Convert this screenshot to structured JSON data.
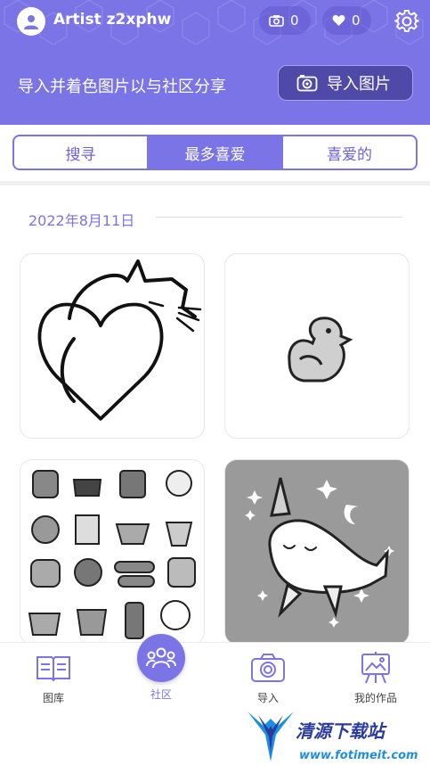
{
  "header": {
    "username": "Artist z2xphw",
    "uploads_count": "0",
    "likes_count": "0",
    "tagline": "导入并着色图片以与社区分享",
    "import_button": "导入图片"
  },
  "tabs": [
    {
      "label": "搜寻",
      "active": false
    },
    {
      "label": "最多喜爱",
      "active": true
    },
    {
      "label": "喜爱的",
      "active": false
    }
  ],
  "feed": {
    "date": "2022年8月11日",
    "items": [
      {
        "subject": "cat heart outline"
      },
      {
        "subject": "rubber duck"
      },
      {
        "subject": "kawaii food collection"
      },
      {
        "subject": "narwhal with stars and moon"
      }
    ]
  },
  "bottom_nav": [
    {
      "label": "图库",
      "icon": "book-icon",
      "active": false
    },
    {
      "label": "社区",
      "icon": "community-icon",
      "active": true
    },
    {
      "label": "导入",
      "icon": "camera-icon",
      "active": false
    },
    {
      "label": "我的作品",
      "icon": "easel-icon",
      "active": false
    }
  ],
  "watermark": {
    "title": "清源下载站",
    "url": "www.fotimeit.com"
  },
  "colors": {
    "accent": "#7b74e6",
    "accent_dark": "#4f4aa8",
    "text_dark": "#333333"
  }
}
